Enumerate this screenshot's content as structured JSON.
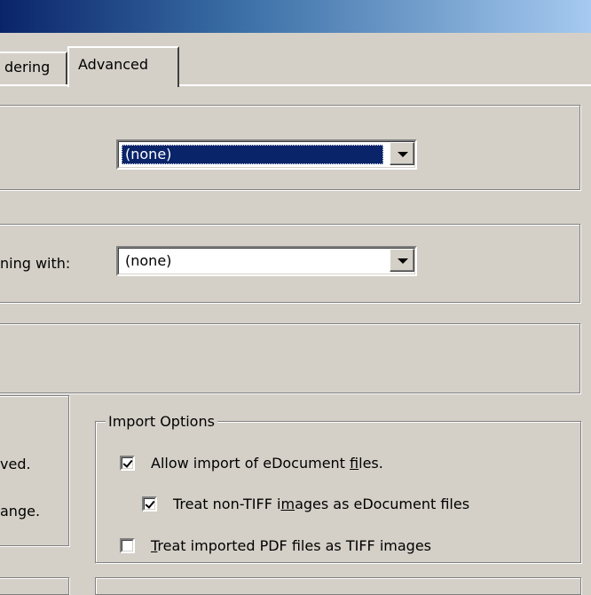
{
  "tabs": {
    "rendering_partial": "dering",
    "advanced": "Advanced"
  },
  "combos": {
    "first": {
      "value": "(none)"
    },
    "second": {
      "label_partial": "ning with:",
      "value": "(none)"
    }
  },
  "left_group": {
    "line1": "ved.",
    "line2": "ange."
  },
  "import_options": {
    "legend": "Import Options",
    "items": [
      {
        "before": "Allow import of eDocument ",
        "underlined": "f",
        "after": "iles.",
        "checked": true
      },
      {
        "before": "Treat non-TIFF i",
        "underlined": "m",
        "after": "ages as eDocument files",
        "checked": true
      },
      {
        "before": "",
        "underlined": "T",
        "after": "reat imported PDF files as TIFF images",
        "checked": false
      }
    ]
  }
}
